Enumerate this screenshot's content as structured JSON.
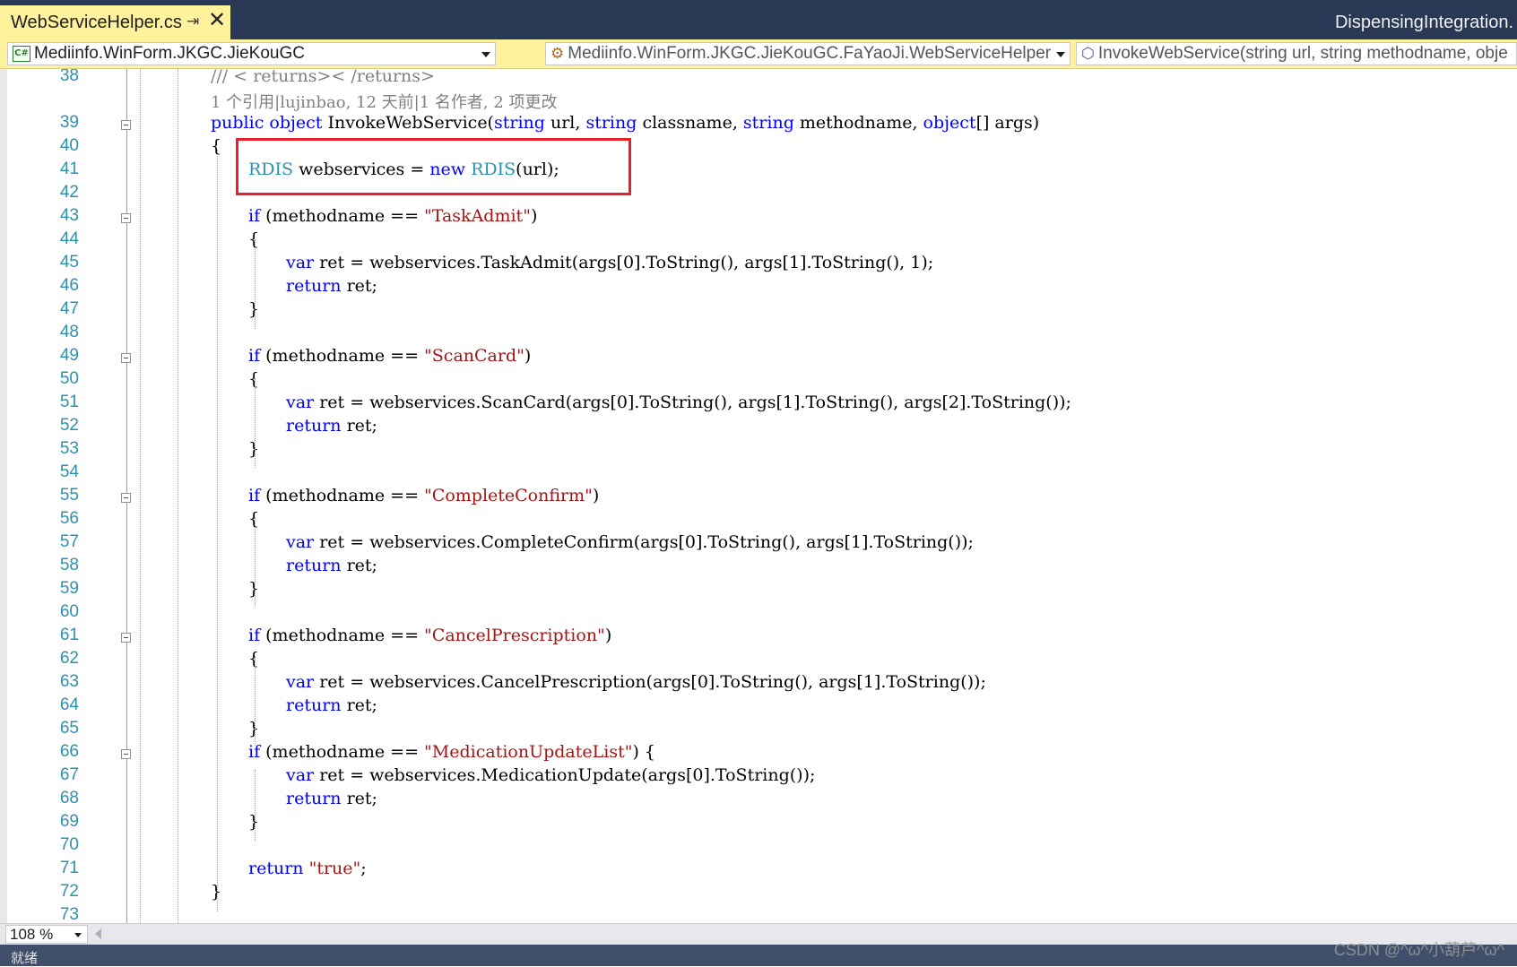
{
  "tab": {
    "title": "WebServiceHelper.cs",
    "pin": "⇥",
    "close": "✕"
  },
  "project_name": "DispensingIntegration.",
  "nav": {
    "project": "Mediinfo.WinForm.JKGC.JieKouGC",
    "class": "Mediinfo.WinForm.JKGC.JieKouGC.FaYaoJi.WebServiceHelper",
    "member": "InvokeWebService(string url, string methodname, obje"
  },
  "codelens": "1 个引用|lujinbao, 12 天前|1 名作者, 2 项更改",
  "lines": [
    {
      "n": "38",
      "indent": 1,
      "tokens": [
        {
          "t": "/// < returns>< /returns>",
          "c": "cm"
        }
      ]
    },
    {
      "n": "",
      "indent": 1,
      "codelens": true,
      "tokens": []
    },
    {
      "n": "39",
      "indent": 1,
      "fold": true,
      "tokens": [
        {
          "t": "public",
          "c": "kw"
        },
        {
          "t": " ",
          "c": "pl"
        },
        {
          "t": "object",
          "c": "kw"
        },
        {
          "t": " InvokeWebService(",
          "c": "pl"
        },
        {
          "t": "string",
          "c": "kw"
        },
        {
          "t": " url, ",
          "c": "pl"
        },
        {
          "t": "string",
          "c": "kw"
        },
        {
          "t": " classname, ",
          "c": "pl"
        },
        {
          "t": "string",
          "c": "kw"
        },
        {
          "t": " methodname, ",
          "c": "pl"
        },
        {
          "t": "object",
          "c": "kw"
        },
        {
          "t": "[] args)",
          "c": "pl"
        }
      ]
    },
    {
      "n": "40",
      "indent": 1,
      "tokens": [
        {
          "t": "{",
          "c": "pl"
        }
      ]
    },
    {
      "n": "41",
      "indent": 2,
      "tokens": [
        {
          "t": "RDIS",
          "c": "tp"
        },
        {
          "t": " webservices = ",
          "c": "pl"
        },
        {
          "t": "new",
          "c": "kw"
        },
        {
          "t": " ",
          "c": "pl"
        },
        {
          "t": "RDIS",
          "c": "tp"
        },
        {
          "t": "(url);",
          "c": "pl"
        }
      ]
    },
    {
      "n": "42",
      "indent": 2,
      "tokens": []
    },
    {
      "n": "43",
      "indent": 2,
      "fold": true,
      "tokens": [
        {
          "t": "if",
          "c": "kw"
        },
        {
          "t": " (methodname == ",
          "c": "pl"
        },
        {
          "t": "\"TaskAdmit\"",
          "c": "st"
        },
        {
          "t": ")",
          "c": "pl"
        }
      ]
    },
    {
      "n": "44",
      "indent": 2,
      "tokens": [
        {
          "t": "{",
          "c": "pl"
        }
      ]
    },
    {
      "n": "45",
      "indent": 3,
      "tokens": [
        {
          "t": "var",
          "c": "kw"
        },
        {
          "t": " ret = webservices.TaskAdmit(args[0].ToString(), args[1].ToString(), 1);",
          "c": "pl"
        }
      ]
    },
    {
      "n": "46",
      "indent": 3,
      "tokens": [
        {
          "t": "return",
          "c": "kw"
        },
        {
          "t": " ret;",
          "c": "pl"
        }
      ]
    },
    {
      "n": "47",
      "indent": 2,
      "tokens": [
        {
          "t": "}",
          "c": "pl"
        }
      ]
    },
    {
      "n": "48",
      "indent": 2,
      "tokens": []
    },
    {
      "n": "49",
      "indent": 2,
      "fold": true,
      "tokens": [
        {
          "t": "if",
          "c": "kw"
        },
        {
          "t": " (methodname == ",
          "c": "pl"
        },
        {
          "t": "\"ScanCard\"",
          "c": "st"
        },
        {
          "t": ")",
          "c": "pl"
        }
      ]
    },
    {
      "n": "50",
      "indent": 2,
      "tokens": [
        {
          "t": "{",
          "c": "pl"
        }
      ]
    },
    {
      "n": "51",
      "indent": 3,
      "tokens": [
        {
          "t": "var",
          "c": "kw"
        },
        {
          "t": " ret = webservices.ScanCard(args[0].ToString(), args[1].ToString(), args[2].ToString());",
          "c": "pl"
        }
      ]
    },
    {
      "n": "52",
      "indent": 3,
      "tokens": [
        {
          "t": "return",
          "c": "kw"
        },
        {
          "t": " ret;",
          "c": "pl"
        }
      ]
    },
    {
      "n": "53",
      "indent": 2,
      "tokens": [
        {
          "t": "}",
          "c": "pl"
        }
      ]
    },
    {
      "n": "54",
      "indent": 2,
      "tokens": []
    },
    {
      "n": "55",
      "indent": 2,
      "fold": true,
      "tokens": [
        {
          "t": "if",
          "c": "kw"
        },
        {
          "t": " (methodname == ",
          "c": "pl"
        },
        {
          "t": "\"CompleteConfirm\"",
          "c": "st"
        },
        {
          "t": ")",
          "c": "pl"
        }
      ]
    },
    {
      "n": "56",
      "indent": 2,
      "tokens": [
        {
          "t": "{",
          "c": "pl"
        }
      ]
    },
    {
      "n": "57",
      "indent": 3,
      "tokens": [
        {
          "t": "var",
          "c": "kw"
        },
        {
          "t": " ret = webservices.CompleteConfirm(args[0].ToString(), args[1].ToString());",
          "c": "pl"
        }
      ]
    },
    {
      "n": "58",
      "indent": 3,
      "tokens": [
        {
          "t": "return",
          "c": "kw"
        },
        {
          "t": " ret;",
          "c": "pl"
        }
      ]
    },
    {
      "n": "59",
      "indent": 2,
      "tokens": [
        {
          "t": "}",
          "c": "pl"
        }
      ]
    },
    {
      "n": "60",
      "indent": 2,
      "tokens": []
    },
    {
      "n": "61",
      "indent": 2,
      "fold": true,
      "tokens": [
        {
          "t": "if",
          "c": "kw"
        },
        {
          "t": " (methodname == ",
          "c": "pl"
        },
        {
          "t": "\"CancelPrescription\"",
          "c": "st"
        },
        {
          "t": ")",
          "c": "pl"
        }
      ]
    },
    {
      "n": "62",
      "indent": 2,
      "tokens": [
        {
          "t": "{",
          "c": "pl"
        }
      ]
    },
    {
      "n": "63",
      "indent": 3,
      "tokens": [
        {
          "t": "var",
          "c": "kw"
        },
        {
          "t": " ret = webservices.CancelPrescription(args[0].ToString(), args[1].ToString());",
          "c": "pl"
        }
      ]
    },
    {
      "n": "64",
      "indent": 3,
      "tokens": [
        {
          "t": "return",
          "c": "kw"
        },
        {
          "t": " ret;",
          "c": "pl"
        }
      ]
    },
    {
      "n": "65",
      "indent": 2,
      "tokens": [
        {
          "t": "}",
          "c": "pl"
        }
      ]
    },
    {
      "n": "66",
      "indent": 2,
      "fold": true,
      "tokens": [
        {
          "t": "if",
          "c": "kw"
        },
        {
          "t": " (methodname == ",
          "c": "pl"
        },
        {
          "t": "\"MedicationUpdateList\"",
          "c": "st"
        },
        {
          "t": ") {",
          "c": "pl"
        }
      ]
    },
    {
      "n": "67",
      "indent": 3,
      "tokens": [
        {
          "t": "var",
          "c": "kw"
        },
        {
          "t": " ret = webservices.MedicationUpdate(args[0].ToString());",
          "c": "pl"
        }
      ]
    },
    {
      "n": "68",
      "indent": 3,
      "tokens": [
        {
          "t": "return",
          "c": "kw"
        },
        {
          "t": " ret;",
          "c": "pl"
        }
      ]
    },
    {
      "n": "69",
      "indent": 2,
      "tokens": [
        {
          "t": "}",
          "c": "pl"
        }
      ]
    },
    {
      "n": "70",
      "indent": 2,
      "tokens": []
    },
    {
      "n": "71",
      "indent": 2,
      "tokens": [
        {
          "t": "return",
          "c": "kw"
        },
        {
          "t": " ",
          "c": "pl"
        },
        {
          "t": "\"true\"",
          "c": "st"
        },
        {
          "t": ";",
          "c": "pl"
        }
      ]
    },
    {
      "n": "72",
      "indent": 1,
      "tokens": [
        {
          "t": "}",
          "c": "pl"
        }
      ]
    },
    {
      "n": "73",
      "indent": 1,
      "tokens": []
    }
  ],
  "zoom": "108 %",
  "status": "就绪",
  "watermark": "CSDN @^ω^小葫芦^ω^",
  "colors": {
    "keyword": "#0000ff",
    "type": "#2b91af",
    "string": "#a31515",
    "comment": "#808080",
    "highlight": "#e8202a",
    "tab_active": "#fff29d",
    "frame": "#293955"
  }
}
